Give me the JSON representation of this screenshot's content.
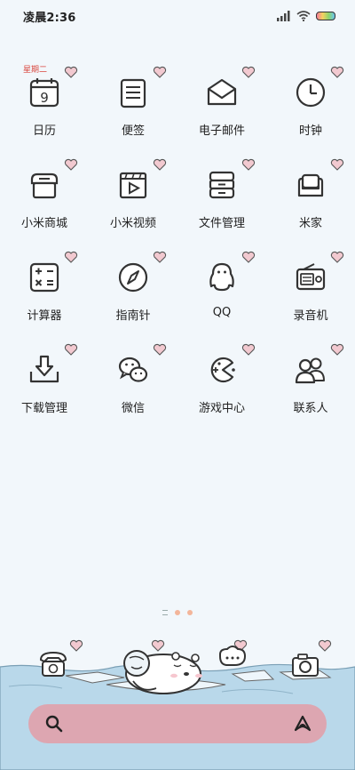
{
  "status_bar": {
    "time": "凌晨2:36"
  },
  "calendar_weekday": "星期二",
  "apps": [
    {
      "label": "日历"
    },
    {
      "label": "便签"
    },
    {
      "label": "电子邮件"
    },
    {
      "label": "时钟"
    },
    {
      "label": "小米商城"
    },
    {
      "label": "小米视频"
    },
    {
      "label": "文件管理"
    },
    {
      "label": "米家"
    },
    {
      "label": "计算器"
    },
    {
      "label": "指南针"
    },
    {
      "label": "QQ"
    },
    {
      "label": "录音机"
    },
    {
      "label": "下载管理"
    },
    {
      "label": "微信"
    },
    {
      "label": "游戏中心"
    },
    {
      "label": "联系人"
    }
  ],
  "dock": [
    "phone-icon",
    "messages-icon",
    "camera-icon"
  ],
  "colors": {
    "background": "#f2f7fb",
    "search_bar": "#dda6b1",
    "heart": "#f2c9d0",
    "water": "#b9d8ea"
  }
}
